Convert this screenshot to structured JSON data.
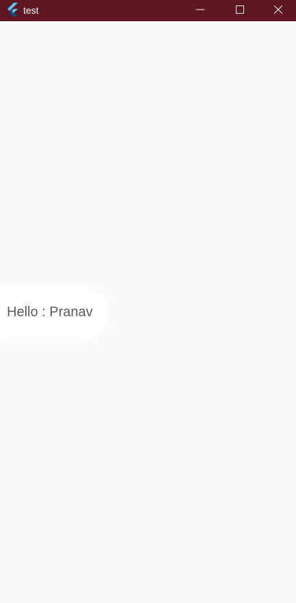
{
  "window": {
    "title": "test",
    "titlebar_color": "#5f1820",
    "background_color": "#fafafa",
    "icons": {
      "app": "flutter-icon",
      "minimize": "minimize-icon",
      "maximize": "maximize-icon",
      "close": "close-icon"
    }
  },
  "main": {
    "greeting": "Hello : Pranav",
    "text_color": "#5c5c5c"
  }
}
